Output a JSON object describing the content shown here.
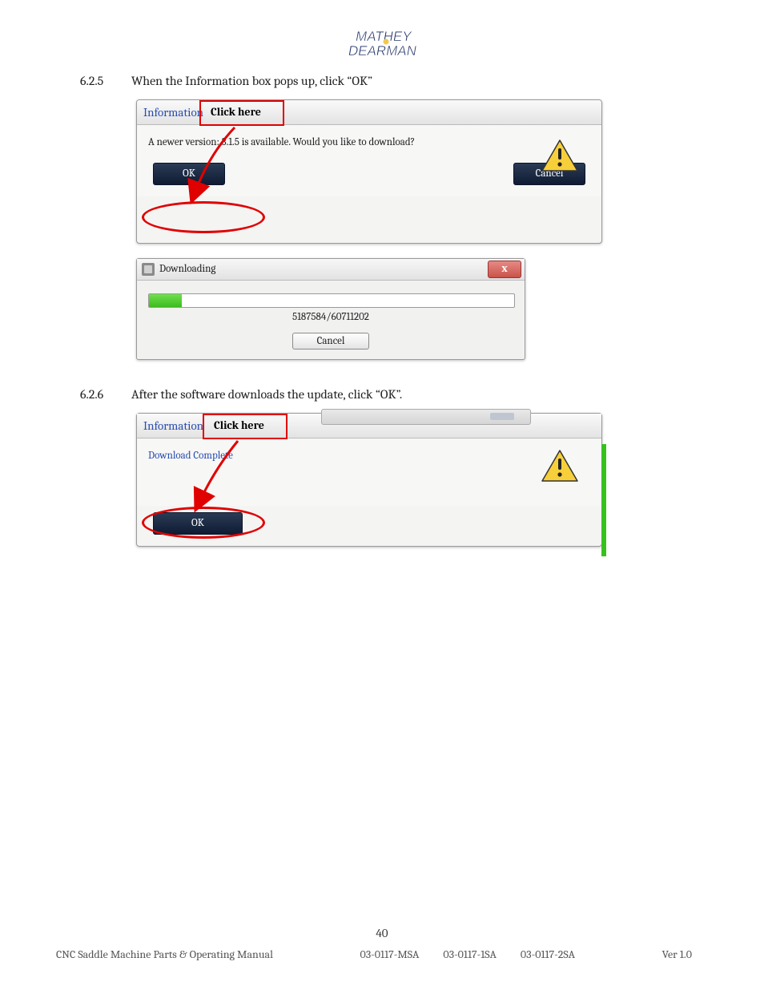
{
  "header": {
    "logo_line1": "MATHEY",
    "logo_line2": "DEARMAN"
  },
  "steps": {
    "s625": {
      "num": "6.2.5",
      "text": "When the Information box pops up, click “OK”"
    },
    "s626": {
      "num": "6.2.6",
      "text": "After the software downloads the update, click “OK”."
    }
  },
  "dialog1": {
    "title": "Information",
    "callout": "Click here",
    "message": "A newer version: 3.1.5 is available. Would you like to download?",
    "ok": "OK",
    "cancel": "Cancel"
  },
  "dialog2": {
    "title": "Downloading",
    "progress_text": "5187584/60711202",
    "progress_pct": 9,
    "cancel": "Cancel",
    "close": "x"
  },
  "dialog3": {
    "title": "Information",
    "callout": "Click here",
    "message": "Download Complete",
    "ok": "OK"
  },
  "footer": {
    "page_number": "40",
    "left": "CNC Saddle Machine Parts & Operating Manual",
    "codes": [
      "03-0117-MSA",
      "03-0117-1SA",
      "03-0117-2SA"
    ],
    "version": "Ver 1.0"
  }
}
